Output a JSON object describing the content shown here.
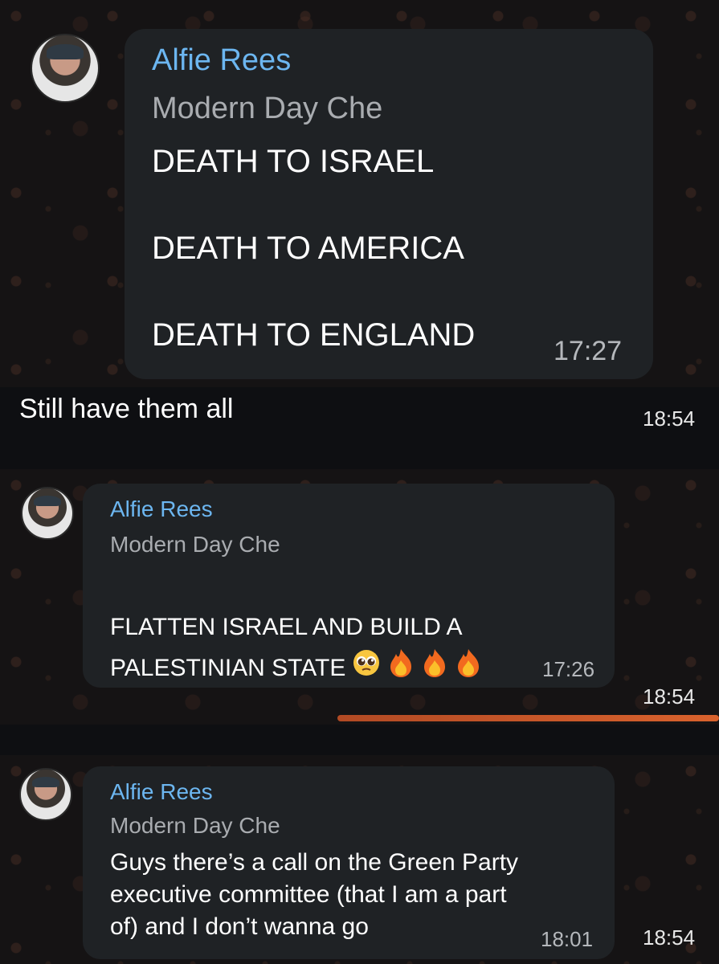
{
  "screenshot_1": {
    "sender": "Alfie Rees",
    "subtitle": "Modern Day Che",
    "text": "DEATH TO ISRAEL\n\nDEATH TO AMERICA\n\nDEATH TO ENGLAND",
    "time": "17:27"
  },
  "reply_1": {
    "text": "Still have them all",
    "time": "18:54"
  },
  "screenshot_2": {
    "sender": "Alfie Rees",
    "subtitle": "Modern Day Che",
    "text": "FLATTEN ISRAEL AND BUILD A\nPALESTINIAN STATE",
    "emojis": [
      "pleading-face-icon",
      "fire-icon",
      "fire-icon",
      "fire-icon"
    ],
    "time": "17:26"
  },
  "reply_2": {
    "time": "18:54"
  },
  "screenshot_3": {
    "sender": "Alfie Rees",
    "subtitle": "Modern Day Che",
    "text": "Guys there’s a call on the Green Party\nexecutive committee (that I am a part\nof) and I don’t wanna go",
    "time": "18:01"
  },
  "reply_3": {
    "time": "18:54"
  },
  "colors": {
    "sender_name": "#6cb6f0",
    "bubble": "#1f2225",
    "accent_bar": "#d9622d"
  }
}
